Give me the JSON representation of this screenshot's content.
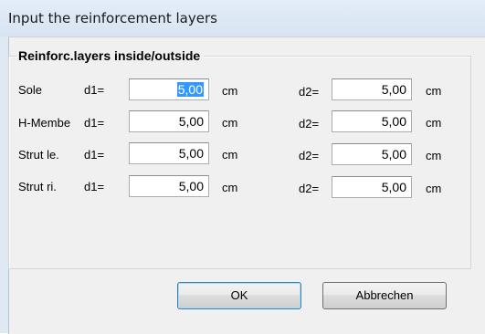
{
  "window": {
    "title": "Input the reinforcement layers"
  },
  "group": {
    "title": "Reinforc.layers inside/outside"
  },
  "rows": [
    {
      "label": "Sole",
      "d1_label": "d1=",
      "d1_value": "5,00",
      "d1_unit": "cm",
      "d2_label": "d2=",
      "d2_value": "5,00",
      "d2_unit": "cm"
    },
    {
      "label": "H-Membe",
      "d1_label": "d1=",
      "d1_value": "5,00",
      "d1_unit": "cm",
      "d2_label": "d2=",
      "d2_value": "5,00",
      "d2_unit": "cm"
    },
    {
      "label": "Strut le.",
      "d1_label": "d1=",
      "d1_value": "5,00",
      "d1_unit": "cm",
      "d2_label": "d2=",
      "d2_value": "5,00",
      "d2_unit": "cm"
    },
    {
      "label": "Strut ri.",
      "d1_label": "d1=",
      "d1_value": "5,00",
      "d1_unit": "cm",
      "d2_label": "d2=",
      "d2_value": "5,00",
      "d2_unit": "cm"
    }
  ],
  "buttons": {
    "ok": "OK",
    "cancel": "Abbrechen"
  }
}
